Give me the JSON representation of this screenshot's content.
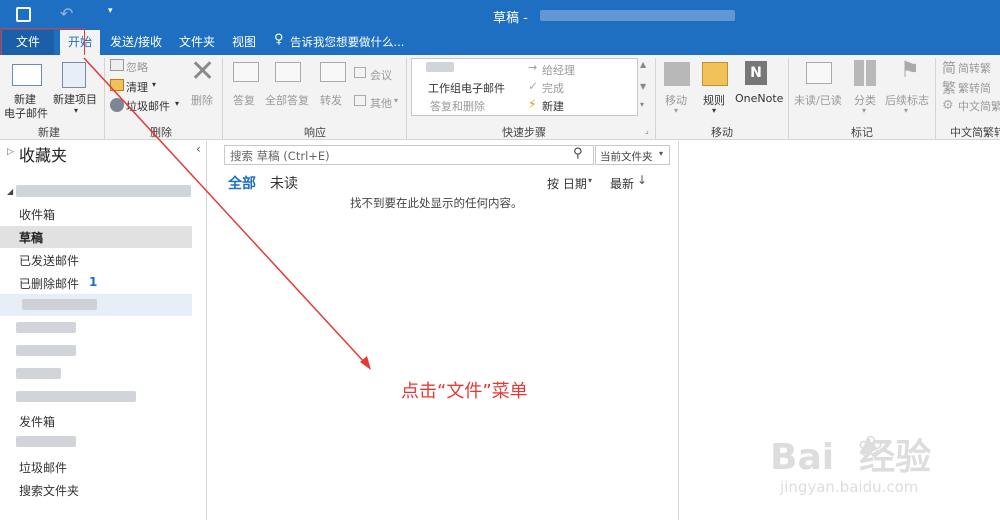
{
  "titlebar": {
    "title": "草稿 - "
  },
  "tabs": {
    "file": "文件",
    "home": "开始",
    "send_receive": "发送/接收",
    "folder": "文件夹",
    "view": "视图",
    "tell_me": "告诉我您想要做什么..."
  },
  "ribbon": {
    "new_email_1": "新建",
    "new_email_2": "电子邮件",
    "new_items_1": "新建项目",
    "group_new": "新建",
    "ignore": "忽略",
    "cleanup": "清理",
    "junk": "垃圾邮件",
    "delete": "删除",
    "group_delete": "删除",
    "reply": "答复",
    "reply_all": "全部答复",
    "forward": "转发",
    "meeting": "会议",
    "more": "其他",
    "group_respond": "响应",
    "qs_to_manager": "给经理",
    "qs_team_email": "工作组电子邮件",
    "qs_done": "完成",
    "qs_reply_delete": "答复和删除",
    "qs_create_new": "新建",
    "group_quicksteps": "快速步骤",
    "move": "移动",
    "rules": "规则",
    "onenote": "OneNote",
    "group_move": "移动",
    "unread_read": "未读/已读",
    "categorize": "分类",
    "follow_up": "后续标志",
    "group_tags": "标记",
    "to_traditional": "简转繁",
    "to_simplified": "繁转简",
    "chinese_conv": "中文简繁",
    "group_chinese": "中文简繁转",
    "char_jian": "简",
    "char_fan": "繁"
  },
  "nav": {
    "favorites": "收藏夹",
    "inbox": "收件箱",
    "drafts": "草稿",
    "sent": "已发送邮件",
    "deleted": "已删除邮件",
    "deleted_count": "1",
    "outbox": "发件箱",
    "junk": "垃圾邮件",
    "search_folders": "搜索文件夹"
  },
  "list": {
    "search_placeholder": "搜索 草稿 (Ctrl+E)",
    "scope": "当前文件夹",
    "filter_all": "全部",
    "filter_unread": "未读",
    "sort_by": "按 日期",
    "sort_order": "最新",
    "empty_message": "找不到要在此处显示的任何内容。"
  },
  "annotation": {
    "text": "点击“文件”菜单"
  },
  "watermark": {
    "logo_text": "Bai  经验",
    "url": "jingyan.baidu.com"
  },
  "colors": {
    "accent": "#1e6fc2",
    "annotation": "#e53935",
    "selected_bg": "#e1e1e1"
  }
}
